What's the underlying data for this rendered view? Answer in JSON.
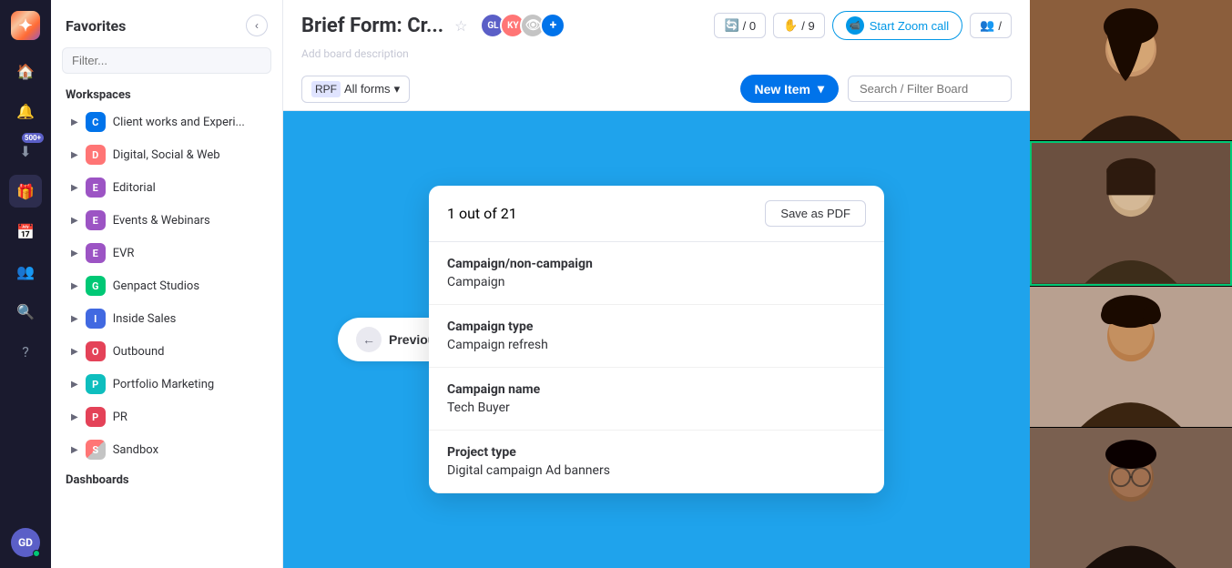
{
  "app": {
    "logo_text": "✦"
  },
  "nav_icons": {
    "home": "🏠",
    "inbox": "🔔",
    "downloads": "⬇",
    "gift": "🎁",
    "calendar": "📅",
    "people": "👥",
    "search": "🔍",
    "help": "?"
  },
  "sidebar": {
    "title": "Favorites",
    "filter_placeholder": "Filter...",
    "workspaces_label": "Workspaces",
    "dashboards_label": "Dashboards",
    "items": [
      {
        "id": "client",
        "label": "Client works and Experi...",
        "color": "dot-blue",
        "letter": "C"
      },
      {
        "id": "digital",
        "label": "Digital, Social & Web",
        "color": "dot-orange",
        "letter": "D"
      },
      {
        "id": "editorial",
        "label": "Editorial",
        "color": "dot-purple",
        "letter": "E"
      },
      {
        "id": "events",
        "label": "Events & Webinars",
        "color": "dot-purple",
        "letter": "E"
      },
      {
        "id": "evr",
        "label": "EVR",
        "color": "dot-purple",
        "letter": "E"
      },
      {
        "id": "genpact",
        "label": "Genpact Studios",
        "color": "dot-green",
        "letter": "G"
      },
      {
        "id": "inside",
        "label": "Inside Sales",
        "color": "dot-darkblue",
        "letter": "I"
      },
      {
        "id": "outbound",
        "label": "Outbound",
        "color": "dot-red",
        "letter": "O"
      },
      {
        "id": "portfolio",
        "label": "Portfolio Marketing",
        "color": "dot-teal",
        "letter": "P"
      },
      {
        "id": "pr",
        "label": "PR",
        "color": "dot-red",
        "letter": "P"
      },
      {
        "id": "sandbox",
        "label": "Sandbox",
        "color": "dot-multi",
        "letter": "S"
      }
    ]
  },
  "header": {
    "board_title": "Brief Form: Cr...",
    "board_description": "Add board description",
    "star": "☆",
    "avatars": [
      "GL",
      "KY",
      "👁"
    ],
    "action_updates": "/ 0",
    "action_activity": "/ 9",
    "zoom_label": "Start Zoom call",
    "persons_label": "/",
    "all_forms_label": "All forms",
    "new_item_label": "New Item",
    "search_placeholder": "Search / Filter Board"
  },
  "form": {
    "counter": "1 out of 21",
    "save_pdf_label": "Save as PDF",
    "fields": [
      {
        "label": "Campaign/non-campaign",
        "value": "Campaign"
      },
      {
        "label": "Campaign type",
        "value": "Campaign refresh"
      },
      {
        "label": "Campaign name",
        "value": "Tech Buyer"
      },
      {
        "label": "Project type",
        "value": "Digital campaign Ad banners"
      }
    ]
  },
  "buttons": {
    "previous_item": "Previous Item"
  },
  "video_tiles": [
    {
      "id": "tile1",
      "bg": "#c0956a"
    },
    {
      "id": "tile2",
      "bg": "#b8935a"
    },
    {
      "id": "tile3",
      "bg": "#8b6b3d"
    },
    {
      "id": "tile4",
      "bg": "#3d2d1e"
    }
  ],
  "colors": {
    "accent_blue": "#0073ea",
    "canvas_bg": "#1fa3ec",
    "sidebar_bg": "#ffffff",
    "dark_bg": "#1a1a2e"
  }
}
